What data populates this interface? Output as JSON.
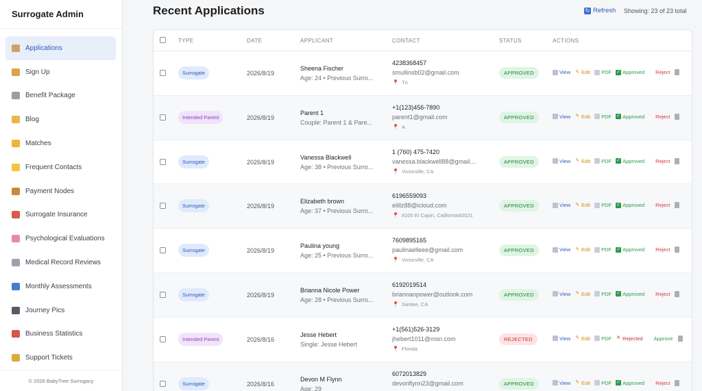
{
  "brand": "Surrogate Admin",
  "nav": [
    {
      "label": "Applications",
      "icon": "clipboard-icon",
      "color": "#c9a36b",
      "active": true
    },
    {
      "label": "Sign Up",
      "icon": "signup-icon",
      "color": "#d9a44a"
    },
    {
      "label": "Benefit Package",
      "icon": "document-icon",
      "color": "#9aa0a8"
    },
    {
      "label": "Blog",
      "icon": "pencil-icon",
      "color": "#e8b64c"
    },
    {
      "label": "Matches",
      "icon": "handshake-icon",
      "color": "#f0b43a"
    },
    {
      "label": "Frequent Contacts",
      "icon": "notepad-icon",
      "color": "#f2c53d"
    },
    {
      "label": "Payment Nodes",
      "icon": "money-bag-icon",
      "color": "#c98a3a"
    },
    {
      "label": "Surrogate Insurance",
      "icon": "shield-icon",
      "color": "#d95b4a"
    },
    {
      "label": "Psychological Evaluations",
      "icon": "brain-icon",
      "color": "#e98aa0"
    },
    {
      "label": "Medical Record Reviews",
      "icon": "stethoscope-icon",
      "color": "#9aa3ad"
    },
    {
      "label": "Monthly Assessments",
      "icon": "bar-chart-icon",
      "color": "#4a7bd0"
    },
    {
      "label": "Journey Pics",
      "icon": "camera-icon",
      "color": "#555c66"
    },
    {
      "label": "Business Statistics",
      "icon": "line-chart-icon",
      "color": "#d9534f"
    },
    {
      "label": "Support Tickets",
      "icon": "ticket-icon",
      "color": "#e0a93a"
    }
  ],
  "footer": "© 2026 BabyTree Surrogacy",
  "header": {
    "title": "Recent Applications",
    "refresh": "Refresh",
    "showing": "Showing: 23 of 23 total"
  },
  "columns": [
    "TYPE",
    "DATE",
    "APPLICANT",
    "CONTACT",
    "STATUS",
    "ACTIONS"
  ],
  "actions": {
    "view": "View",
    "edit": "Edit",
    "pdf": "PDF",
    "approved": "Approved",
    "reject": "Reject",
    "rejected": "Rejected",
    "approve": "Approve"
  },
  "rows": [
    {
      "type": "Surrogate",
      "kind": "surrogate",
      "date": "2026/8/19",
      "name": "Sheena Fischer",
      "sub": "Age: 24 • Previous Surro...",
      "phone": "4238368457",
      "email": "smullinsb02@gmail.com",
      "loc": "Tn",
      "status": "APPROVED",
      "st": "approved"
    },
    {
      "type": "Intended Parent",
      "kind": "parent",
      "date": "2026/8/19",
      "name": "Parent 1",
      "sub": "Couple: Parent 1 & Pare...",
      "phone": "+1(123)456-7890",
      "email": "parent1@gmail.com",
      "loc": "A",
      "status": "APPROVED",
      "st": "approved"
    },
    {
      "type": "Surrogate",
      "kind": "surrogate",
      "date": "2026/8/19",
      "name": "Vanessa Blackwell",
      "sub": "Age: 38 • Previous Surro...",
      "phone": "1 (760) 475-7420",
      "email": "vanessa.blackwell88@gmail....",
      "loc": "Victorville, CA",
      "status": "APPROVED",
      "st": "approved"
    },
    {
      "type": "Surrogate",
      "kind": "surrogate",
      "date": "2026/8/19",
      "name": "Elizabeth brown",
      "sub": "Age: 37 • Previous Surro...",
      "phone": "6196559093",
      "email": "elillz88@icloud.com",
      "loc": "#105 El Cajon, California92021",
      "status": "APPROVED",
      "st": "approved"
    },
    {
      "type": "Surrogate",
      "kind": "surrogate",
      "date": "2026/8/19",
      "name": "Paulina young",
      "sub": "Age: 25 • Previous Surro...",
      "phone": "7609895165",
      "email": "paulinaelleee@gmail.com",
      "loc": "Victorville, CA",
      "status": "APPROVED",
      "st": "approved"
    },
    {
      "type": "Surrogate",
      "kind": "surrogate",
      "date": "2026/8/19",
      "name": "Brianna Nicole Power",
      "sub": "Age: 28 • Previous Surro...",
      "phone": "6192019514",
      "email": "briannanpower@outlook.com",
      "loc": "Santee, CA",
      "status": "APPROVED",
      "st": "approved"
    },
    {
      "type": "Intended Parent",
      "kind": "parent",
      "date": "2026/8/16",
      "name": "Jesse Hebert",
      "sub": "Single: Jesse Hebert",
      "phone": "+1(561)526-3129",
      "email": "jhebert1011@msn.com",
      "loc": "Florida",
      "status": "REJECTED",
      "st": "rejected"
    },
    {
      "type": "Surrogate",
      "kind": "surrogate",
      "date": "2026/8/16",
      "name": "Devon M Flynn",
      "sub": "Age: 29",
      "phone": "6072013829",
      "email": "devonflynn23@gmail.com",
      "loc": "",
      "status": "APPROVED",
      "st": "approved"
    }
  ]
}
